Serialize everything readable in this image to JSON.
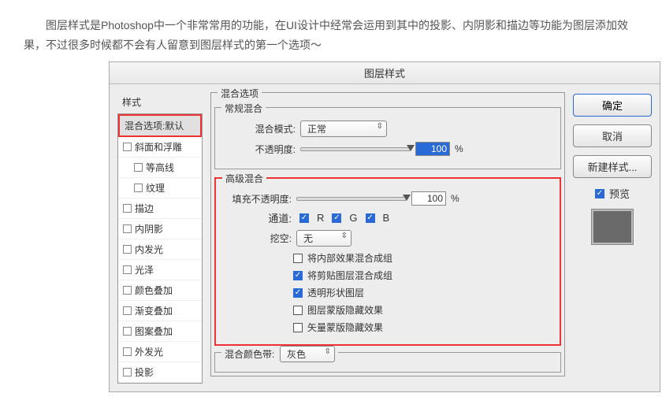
{
  "article": {
    "paragraph": "图层样式是Photoshop中一个非常常用的功能，在UI设计中经常会运用到其中的投影、内阴影和描边等功能为图层添加效果，不过很多时候都不会有人留意到图层样式的第一个选项～"
  },
  "dialog": {
    "title": "图层样式",
    "sidebar": {
      "title": "样式",
      "items": [
        {
          "label": "混合选项:默认",
          "selected": true,
          "checkbox": false
        },
        {
          "label": "斜面和浮雕",
          "checkbox": true
        },
        {
          "label": "等高线",
          "checkbox": true,
          "sub": true
        },
        {
          "label": "纹理",
          "checkbox": true,
          "sub": true
        },
        {
          "label": "描边",
          "checkbox": true
        },
        {
          "label": "内阴影",
          "checkbox": true
        },
        {
          "label": "内发光",
          "checkbox": true
        },
        {
          "label": "光泽",
          "checkbox": true
        },
        {
          "label": "颜色叠加",
          "checkbox": true
        },
        {
          "label": "渐变叠加",
          "checkbox": true
        },
        {
          "label": "图案叠加",
          "checkbox": true
        },
        {
          "label": "外发光",
          "checkbox": true
        },
        {
          "label": "投影",
          "checkbox": true
        }
      ]
    },
    "blending": {
      "section": "混合选项",
      "general": {
        "legend": "常规混合",
        "blend_label": "混合模式:",
        "blend_value": "正常",
        "opacity_label": "不透明度:",
        "opacity_value": "100",
        "opacity_suffix": "%"
      },
      "advanced": {
        "legend": "高级混合",
        "fill_label": "填充不透明度:",
        "fill_value": "100",
        "fill_suffix": "%",
        "channels_label": "通道:",
        "ch_r": "R",
        "ch_g": "G",
        "ch_b": "B",
        "knockout_label": "挖空:",
        "knockout_value": "无",
        "opt1": "将内部效果混合成组",
        "opt2": "将剪贴图层混合成组",
        "opt3": "透明形状图层",
        "opt4": "图层蒙版隐藏效果",
        "opt5": "矢量蒙版隐藏效果"
      },
      "blendif": {
        "legend": "混合颜色带:",
        "value": "灰色"
      }
    },
    "right": {
      "ok": "确定",
      "cancel": "取消",
      "new_style": "新建样式...",
      "preview": "预览"
    }
  }
}
